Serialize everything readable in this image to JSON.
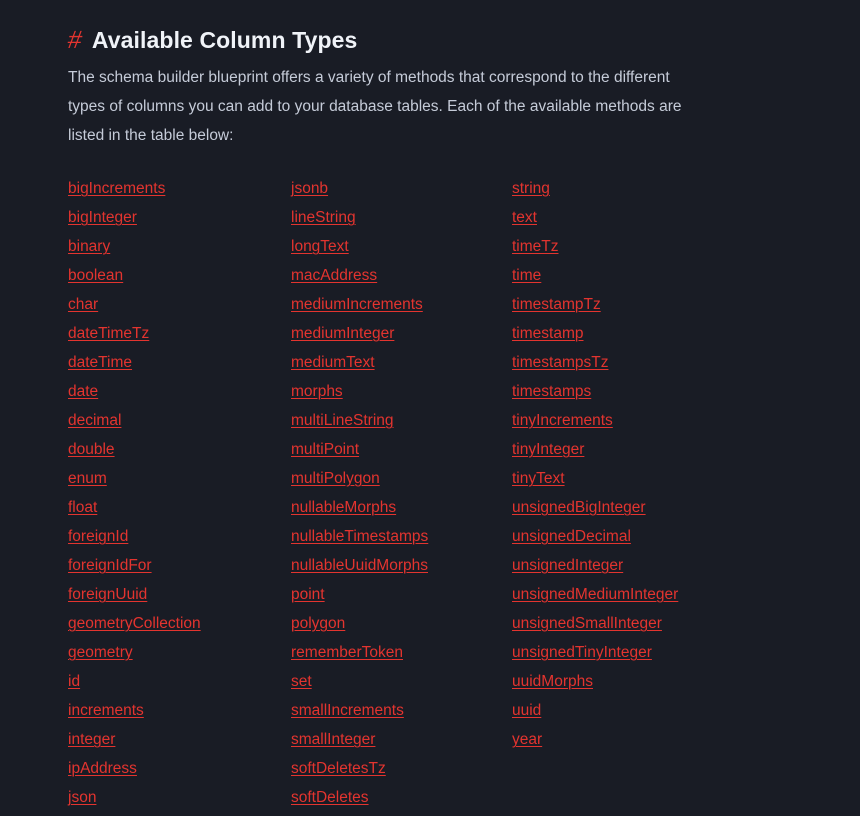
{
  "theme": {
    "background": "#191c25",
    "heading_color": "#f0f3f8",
    "paragraph_color": "#c5cbd8",
    "link_color": "#e3342f",
    "anchor_color": "#e3342f"
  },
  "heading": {
    "anchor_symbol": "#",
    "title": "Available Column Types"
  },
  "intro": {
    "paragraph": "The schema builder blueprint offers a variety of methods that correspond to the different types of columns you can add to your database tables. Each of the available methods are listed in the table below:"
  },
  "column_types": {
    "columns": [
      [
        "bigIncrements",
        "bigInteger",
        "binary",
        "boolean",
        "char",
        "dateTimeTz",
        "dateTime",
        "date",
        "decimal",
        "double",
        "enum",
        "float",
        "foreignId",
        "foreignIdFor",
        "foreignUuid",
        "geometryCollection",
        "geometry",
        "id",
        "increments",
        "integer",
        "ipAddress",
        "json"
      ],
      [
        "jsonb",
        "lineString",
        "longText",
        "macAddress",
        "mediumIncrements",
        "mediumInteger",
        "mediumText",
        "morphs",
        "multiLineString",
        "multiPoint",
        "multiPolygon",
        "nullableMorphs",
        "nullableTimestamps",
        "nullableUuidMorphs",
        "point",
        "polygon",
        "rememberToken",
        "set",
        "smallIncrements",
        "smallInteger",
        "softDeletesTz",
        "softDeletes"
      ],
      [
        "string",
        "text",
        "timeTz",
        "time",
        "timestampTz",
        "timestamp",
        "timestampsTz",
        "timestamps",
        "tinyIncrements",
        "tinyInteger",
        "tinyText",
        "unsignedBigInteger",
        "unsignedDecimal",
        "unsignedInteger",
        "unsignedMediumInteger",
        "unsignedSmallInteger",
        "unsignedTinyInteger",
        "uuidMorphs",
        "uuid",
        "year"
      ]
    ]
  }
}
